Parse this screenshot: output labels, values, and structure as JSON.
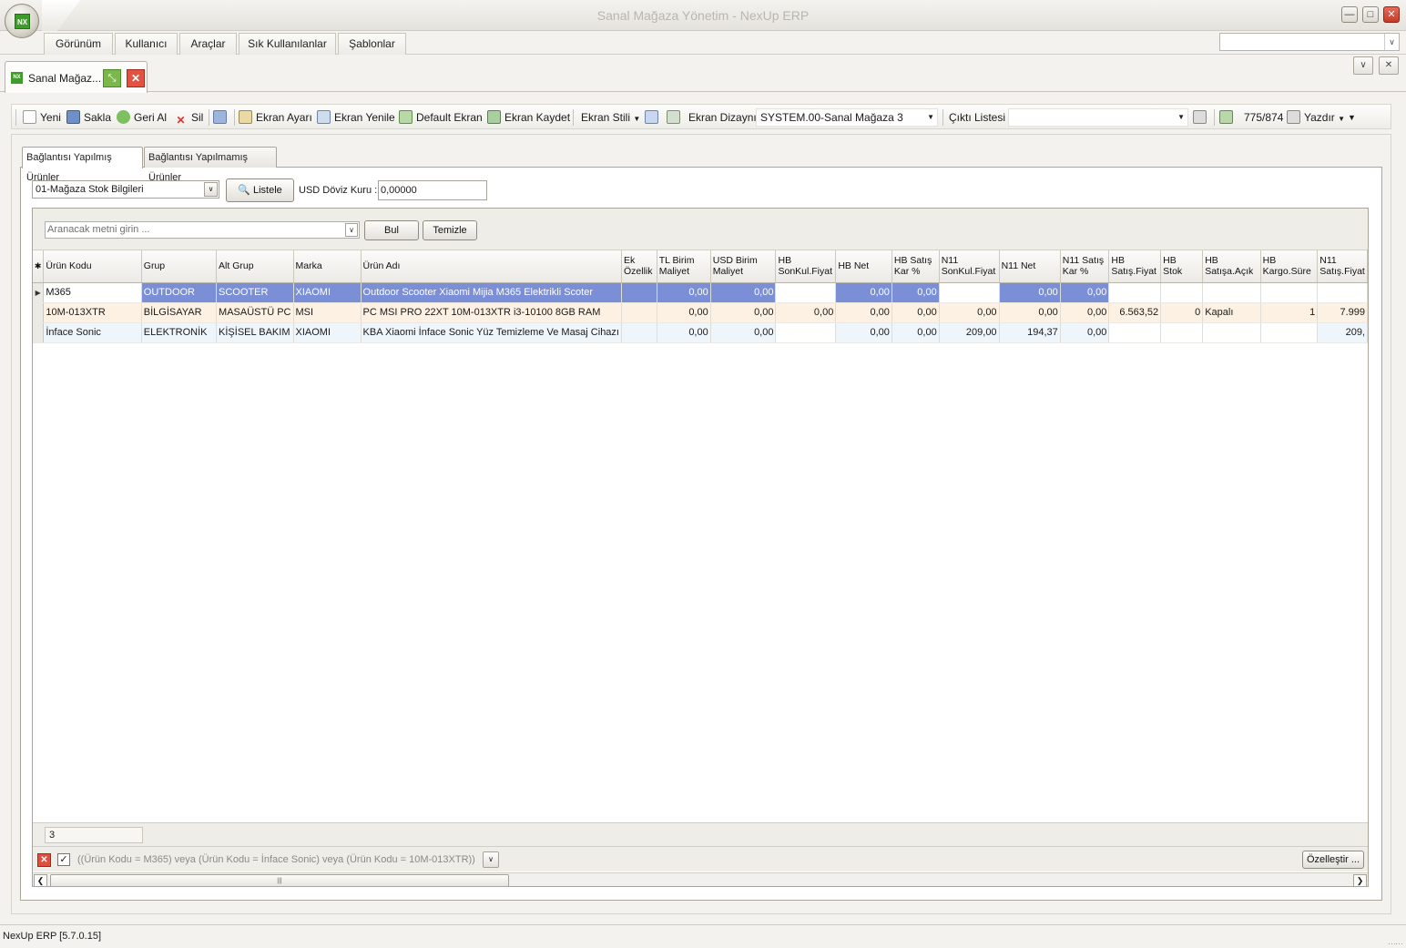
{
  "window": {
    "title": "Sanal Mağaza Yönetim - NexUp ERP",
    "logo_text": "NX"
  },
  "menu": {
    "items": [
      "Görünüm",
      "Kullanıcı",
      "Araçlar",
      "Sık Kullanılanlar",
      "Şablonlar"
    ]
  },
  "doc_tab": {
    "label": "Sanal Mağaz..."
  },
  "toolbar": {
    "new": "Yeni",
    "save": "Sakla",
    "undo": "Geri Al",
    "delete": "Sil",
    "screen_settings": "Ekran Ayarı",
    "screen_refresh": "Ekran Yenile",
    "default_screen": "Default Ekran",
    "screen_save": "Ekran Kaydet",
    "screen_style": "Ekran Stili",
    "screen_design": "Ekran Dizaynı",
    "design_value": "SYSTEM.00-Sanal Mağaza 3",
    "output_list": "Çıktı Listesi",
    "counter": "775/874",
    "print": "Yazdır"
  },
  "tabs": [
    "Bağlantısı Yapılmış Ürünler",
    "Bağlantısı Yapılmamış Ürünler"
  ],
  "form": {
    "source_value": "01-Mağaza Stok Bilgileri",
    "list_button": "Listele",
    "usd_label": "USD Döviz Kuru :",
    "usd_value": "0,00000"
  },
  "find": {
    "placeholder": "Aranacak metni girin ...",
    "find_button": "Bul",
    "clear_button": "Temizle"
  },
  "grid": {
    "columns": [
      "Ürün Kodu",
      "Grup",
      "Alt Grup",
      "Marka",
      "Ürün Adı",
      "Ek\nÖzellik",
      "TL Birim\nMaliyet",
      "USD Birim\nMaliyet",
      "HB\nSonKul.Fiyat",
      "HB   Net",
      "HB   Satış\nKar %",
      "N11\nSonKul.Fiyat",
      "N11   Net",
      "N11   Satış\nKar %",
      "HB\nSatış.Fiyat",
      "HB\nStok",
      "HB\nSatışa.Açık",
      "HB\nKargo.Süre",
      "N11\nSatış.Fiyat"
    ],
    "rows": [
      {
        "code": "M365",
        "group": "OUTDOOR",
        "subgroup": "SCOOTER",
        "brand": "XIAOMI",
        "name": "Outdoor Scooter Xiaomi Mijia M365 Elektrikli Scoter",
        "extra": "",
        "tl_cost": "0,00",
        "usd_cost": "0,00",
        "hb_last_price": "",
        "hb_net": "0,00",
        "hb_margin": "0,00",
        "n11_last_price": "",
        "n11_net": "0,00",
        "n11_margin": "0,00",
        "hb_price": "",
        "hb_stock": "",
        "hb_open": "",
        "hb_cargo": "",
        "n11_price": ""
      },
      {
        "code": "10M-013XTR",
        "group": "BİLGİSAYAR",
        "subgroup": "MASAÜSTÜ PC",
        "brand": "MSI",
        "name": "PC MSI PRO 22XT 10M-013XTR i3-10100 8GB RAM",
        "extra": "",
        "tl_cost": "0,00",
        "usd_cost": "0,00",
        "hb_last_price": "0,00",
        "hb_net": "0,00",
        "hb_margin": "0,00",
        "n11_last_price": "0,00",
        "n11_net": "0,00",
        "n11_margin": "0,00",
        "hb_price": "6.563,52",
        "hb_stock": "0",
        "hb_open": "Kapalı",
        "hb_cargo": "1",
        "n11_price": "7.999"
      },
      {
        "code": "İnface Sonic",
        "group": "ELEKTRONİK",
        "subgroup": "KİŞİSEL BAKIM",
        "brand": "XIAOMI",
        "name": "KBA Xiaomi İnface Sonic Yüz Temizleme Ve Masaj Cihazı",
        "extra": "",
        "tl_cost": "0,00",
        "usd_cost": "0,00",
        "hb_last_price": "",
        "hb_net": "0,00",
        "hb_margin": "0,00",
        "n11_last_price": "209,00",
        "n11_net": "194,37",
        "n11_margin": "0,00",
        "hb_price": "",
        "hb_stock": "",
        "hb_open": "",
        "hb_cargo": "",
        "n11_price": "209,"
      }
    ],
    "footer_count": "3",
    "filter_text": "((Ürün Kodu = M365) veya (Ürün Kodu = İnface Sonic) veya (Ürün Kodu = 10M-013XTR))",
    "customize_button": "Özelleştir ..."
  },
  "status": {
    "version": "NexUp ERP [5.7.0.15]"
  }
}
